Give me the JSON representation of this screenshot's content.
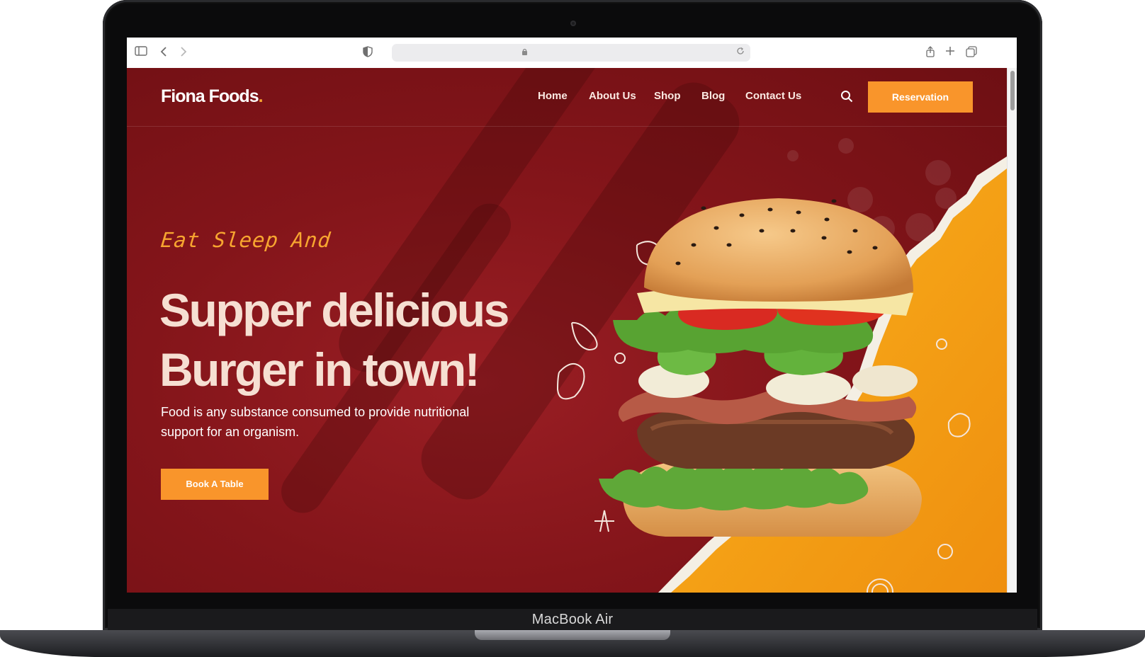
{
  "device": {
    "model_label": "MacBook Air"
  },
  "site": {
    "logo_text": "Fiona Foods",
    "logo_dot": ".",
    "nav": [
      {
        "label": "Home"
      },
      {
        "label": "About Us"
      },
      {
        "label": "Shop"
      },
      {
        "label": "Blog"
      },
      {
        "label": "Contact Us"
      }
    ],
    "reservation_label": "Reservation",
    "hero": {
      "tagline": "Eat Sleep And",
      "headline_line1": "Supper delicious",
      "headline_line2": "Burger in town!",
      "description": "Food is any substance consumed to provide nutritional support for an organism.",
      "cta_label": "Book A Table"
    }
  },
  "colors": {
    "hero_bg": "#84151a",
    "accent": "#f9952b",
    "headline": "#f6dfd2",
    "accent_yellow": "#f5a615"
  }
}
